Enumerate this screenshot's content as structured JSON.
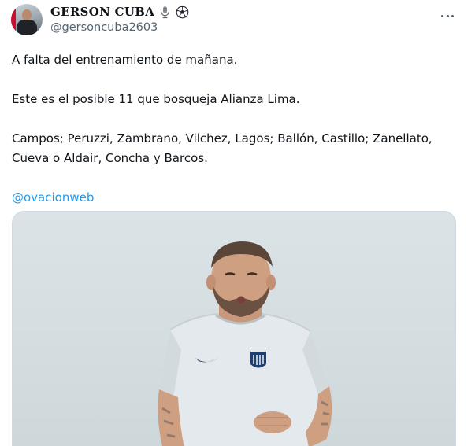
{
  "author": {
    "display_name": "GERSON CUBA",
    "name_emojis": [
      "microphone-icon",
      "soccer-ball-icon"
    ],
    "handle": "@gersoncuba2603"
  },
  "tweet": {
    "paragraphs": [
      "A falta del entrenamiento de mañana.",
      "Este es el posible 11 que bosqueja Alianza Lima.",
      "Campos; Peruzzi, Zambrano, Vilchez, Lagos; Ballón, Castillo; Zanellato,\nCueva o Aldair, Concha y Barcos."
    ],
    "mention": "@ovacionweb"
  },
  "media": {
    "description_icon": "player-photo"
  },
  "colors": {
    "text": "#0f1419",
    "secondary": "#536471",
    "link": "#1d9bf0",
    "border": "#cfd9de"
  }
}
